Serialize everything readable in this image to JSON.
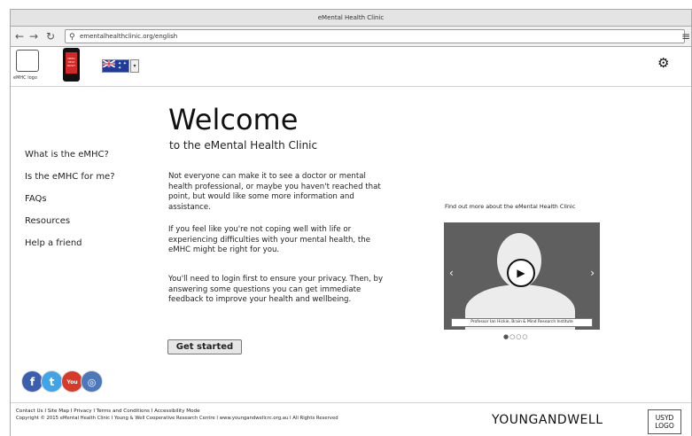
{
  "window": {
    "title": "eMental Health Clinic"
  },
  "browser": {
    "back_icon": "arrow-left",
    "forward_icon": "arrow-right",
    "reload_icon": "reload",
    "url": "ementalhealthclinic.org/english",
    "menu_icon": "hamburger-menu"
  },
  "header": {
    "logo_caption": "eMHC logo",
    "phone_text": "NEED HELP NOW?",
    "language_flag": "australia-flag",
    "settings_icon": "gear"
  },
  "sidebar": {
    "items": [
      {
        "label": "What is the eMHC?"
      },
      {
        "label": "Is the eMHC for me?"
      },
      {
        "label": "FAQs"
      },
      {
        "label": "Resources"
      },
      {
        "label": "Help a friend"
      }
    ]
  },
  "main": {
    "heading": "Welcome",
    "subheading": "to the eMental Health Clinic",
    "paragraphs": [
      "Not everyone can make it to see a doctor or mental health professional, or maybe you haven't reached that point, but would like some more information and assistance.",
      "If you feel like you're not coping well with life or experiencing difficulties with your mental health, the eMHC might be right for you.",
      "You'll need to login first to ensure your privacy. Then, by answering some questions you can get immediate feedback to improve your health and wellbeing."
    ],
    "cta_label": "Get started"
  },
  "video": {
    "label": "Find out more about the eMental Health Clinic",
    "caption": "Professor Ian Hickie, Brain & Mind Research Institute",
    "prev": "‹",
    "next": "›",
    "slide_indicator": "●○○○"
  },
  "social": {
    "facebook": "f",
    "twitter": "t",
    "youtube": "You",
    "instagram": "◎"
  },
  "footer": {
    "links": "Contact Us I Site Map I Privacy I Terms and Conditions I Accessibility Mode",
    "copyright": "Copyright © 2015 eMental Health Clinic I Young & Well Cooperative Research Centre I www.youngandwellcrc.org.au I All Rights Reserved",
    "partner": "YOUNGANDWELL",
    "usyd_logo": "USYD LOGO"
  }
}
